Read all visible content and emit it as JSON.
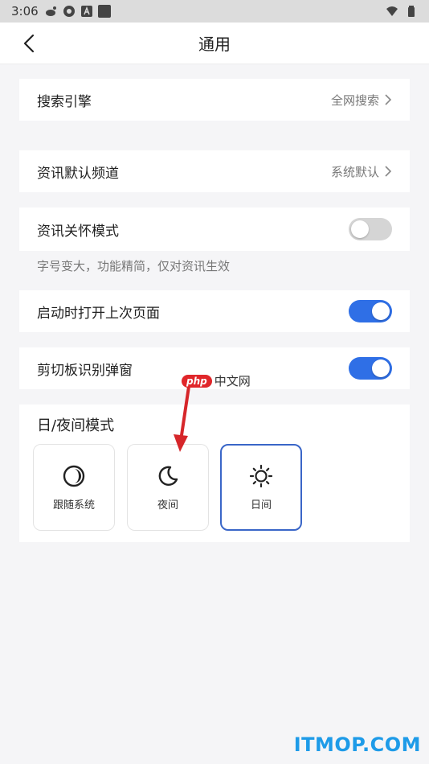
{
  "status_bar": {
    "time": "3:06"
  },
  "header": {
    "title": "通用"
  },
  "settings": {
    "search_engine": {
      "label": "搜索引擎",
      "value": "全网搜索"
    },
    "news_channel": {
      "label": "资讯默认频道",
      "value": "系统默认"
    },
    "care_mode": {
      "label": "资讯关怀模式",
      "enabled": false,
      "hint": "字号变大，功能精简，仅对资讯生效"
    },
    "restore_last_page": {
      "label": "启动时打开上次页面",
      "enabled": true
    },
    "clipboard_popup": {
      "label": "剪切板识别弹窗",
      "enabled": true
    }
  },
  "day_night": {
    "title": "日/夜间模式",
    "options": [
      {
        "label": "跟随系统",
        "icon": "half-moon-icon"
      },
      {
        "label": "夜间",
        "icon": "moon-icon"
      },
      {
        "label": "日间",
        "icon": "sun-icon"
      }
    ],
    "selected": "日间"
  },
  "colors": {
    "accent": "#2f6fe6",
    "toggle_off": "#d5d5d5",
    "selected_border": "#3a66c8",
    "watermark": "#1e9be8"
  },
  "watermarks": {
    "php_logo": "php",
    "php_text": "中文网",
    "itmop": "ITMOP.COM"
  }
}
